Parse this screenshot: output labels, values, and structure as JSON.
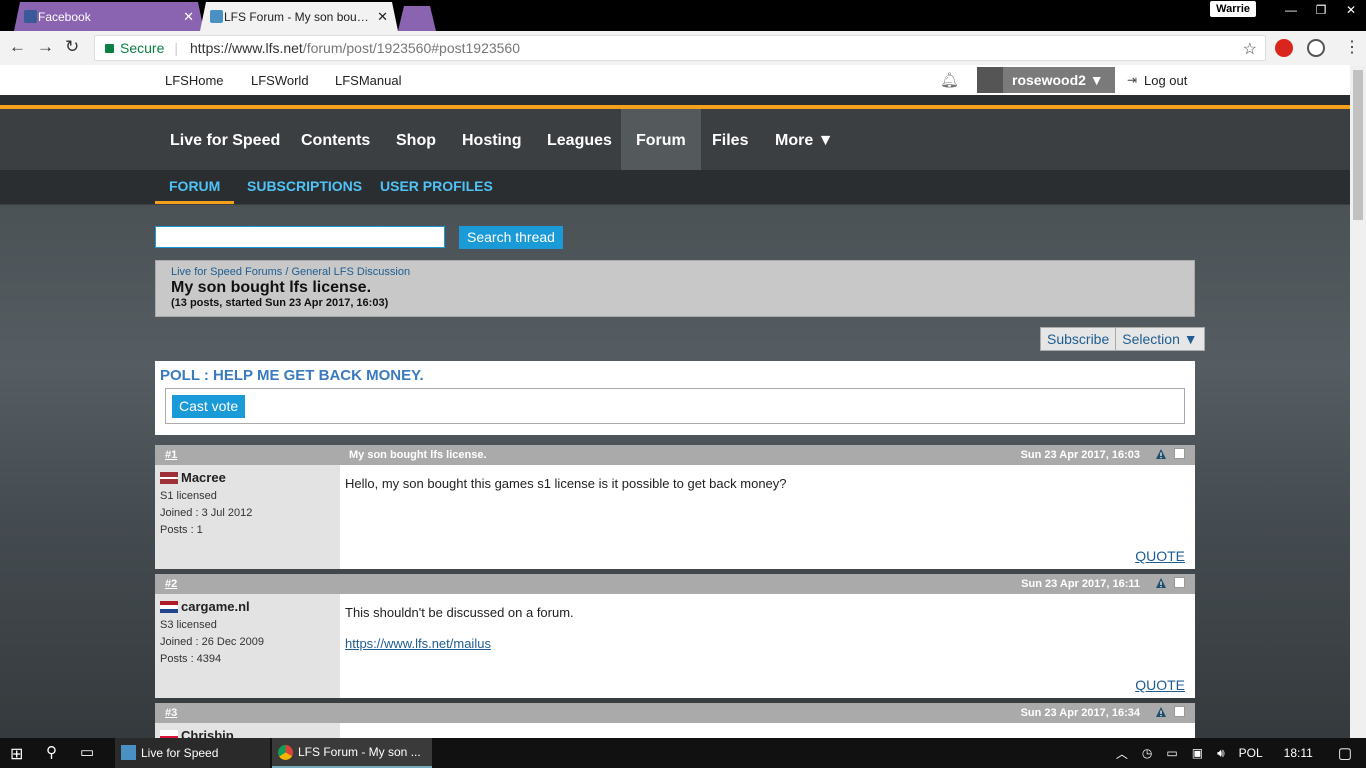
{
  "browser": {
    "tabs": [
      {
        "title": "Facebook"
      },
      {
        "title": "LFS Forum - My son bou…"
      }
    ],
    "profile_chip": "Warrie",
    "address": {
      "secure_label": "Secure",
      "host": "https://www.lfs.net",
      "path": "/forum/post/1923560#post1923560"
    }
  },
  "topbar": {
    "links": [
      "LFSHome",
      "LFSWorld",
      "LFSManual"
    ],
    "username": "rosewood2 ▼",
    "logout": "Log out"
  },
  "main_nav": [
    "Live for Speed",
    "Contents",
    "Shop",
    "Hosting",
    "Leagues",
    "Forum",
    "Files",
    "More ▼"
  ],
  "sub_nav": [
    "FORUM",
    "SUBSCRIPTIONS",
    "USER PROFILES"
  ],
  "search": {
    "button": "Search thread",
    "value": ""
  },
  "thread": {
    "breadcrumb_root": "Live for Speed Forums",
    "breadcrumb_sep": " / ",
    "breadcrumb_section": "General LFS Discussion",
    "title": "My son bought lfs license.",
    "subtitle": "(13 posts, started Sun 23 Apr 2017, 16:03)"
  },
  "actions": {
    "subscribe": "Subscribe",
    "selection": "Selection ▼"
  },
  "poll": {
    "title": "POLL : HELP ME GET BACK MONEY.",
    "vote_button": "Cast vote"
  },
  "posts": [
    {
      "num": "#1",
      "head_title": "My son bought lfs license.",
      "date": "Sun 23 Apr 2017, 16:03",
      "user": "Macree",
      "license": "S1 licensed",
      "joined": "Joined : 3 Jul 2012",
      "posts": "Posts : 1",
      "body": "Hello, my son bought this games s1 license is it possible to get back money?",
      "link": "",
      "quote": "QUOTE"
    },
    {
      "num": "#2",
      "head_title": "",
      "date": "Sun 23 Apr 2017, 16:11",
      "user": "cargame.nl",
      "license": "S3 licensed",
      "joined": "Joined : 26 Dec 2009",
      "posts": "Posts : 4394",
      "body": "This shouldn't be discussed on a forum.",
      "link": "https://www.lfs.net/mailus",
      "quote": "QUOTE"
    },
    {
      "num": "#3",
      "head_title": "",
      "date": "Sun 23 Apr 2017, 16:34",
      "user": "Chrisbip"
    }
  ],
  "taskbar": {
    "apps": [
      "Live for Speed",
      "LFS Forum - My son ..."
    ],
    "lang": "POL",
    "time": "18:11"
  },
  "colors": {
    "accent": "#1a9ad6",
    "orange": "#f4a01c",
    "nav_bg": "#3b3f42"
  }
}
